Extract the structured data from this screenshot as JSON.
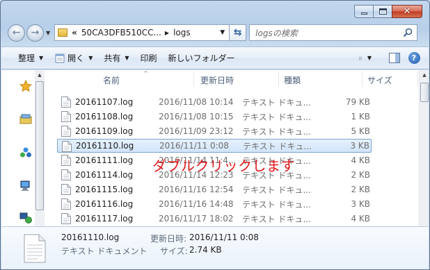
{
  "window": {
    "caption_buttons": [
      "minimize",
      "maximize",
      "close"
    ]
  },
  "navigation": {
    "back_icon": "back-arrow-icon",
    "forward_icon": "forward-arrow-icon",
    "address": {
      "overflow": "«",
      "parent": "50CA3DFB510CC...",
      "current": "logs"
    },
    "search": {
      "placeholder": "logsの検索"
    }
  },
  "toolbar": {
    "organize": "整理",
    "open": "開く",
    "share": "共有",
    "print": "印刷",
    "new_folder": "新しいフォルダー"
  },
  "columns": {
    "name": "名前",
    "modified": "更新日時",
    "type": "種類",
    "size": "サイズ"
  },
  "files": [
    {
      "name": "20161107.log",
      "modified": "2016/11/08 10:14",
      "type": "テキスト ドキュ...",
      "size": "79 KB"
    },
    {
      "name": "20161108.log",
      "modified": "2016/11/08 10:15",
      "type": "テキスト ドキュ...",
      "size": "1 KB"
    },
    {
      "name": "20161109.log",
      "modified": "2016/11/09 23:12",
      "type": "テキスト ドキュ...",
      "size": "5 KB"
    },
    {
      "name": "20161110.log",
      "modified": "2016/11/11 0:08",
      "type": "テキスト ドキュ...",
      "size": "3 KB",
      "selected": true
    },
    {
      "name": "20161111.log",
      "modified": "2016/11/14 11:4...",
      "type": "テキスト ドキュ...",
      "size": "4 KB"
    },
    {
      "name": "20161114.log",
      "modified": "2016/11/14 12:23",
      "type": "テキスト ドキュ...",
      "size": "2 KB"
    },
    {
      "name": "20161115.log",
      "modified": "2016/11/16 12:54",
      "type": "テキスト ドキュ...",
      "size": "2 KB"
    },
    {
      "name": "20161116.log",
      "modified": "2016/11/16 14:48",
      "type": "テキスト ドキュ...",
      "size": "3 KB"
    },
    {
      "name": "20161117.log",
      "modified": "2016/11/17 18:02",
      "type": "テキスト ドキュ...",
      "size": "4 KB"
    }
  ],
  "annotation": {
    "text": "ダブルクリックします",
    "color": "#e0191c"
  },
  "details": {
    "name": "20161110.log",
    "type": "テキスト ドキュメント",
    "modified_label": "更新日時:",
    "modified_value": "2016/11/11 0:08",
    "size_label": "サイズ:",
    "size_value": "2.74 KB"
  },
  "colors": {
    "chrome": "#c3d8ee",
    "selection_border": "#7da2ce",
    "selection_fill": "#d2e5fa"
  }
}
